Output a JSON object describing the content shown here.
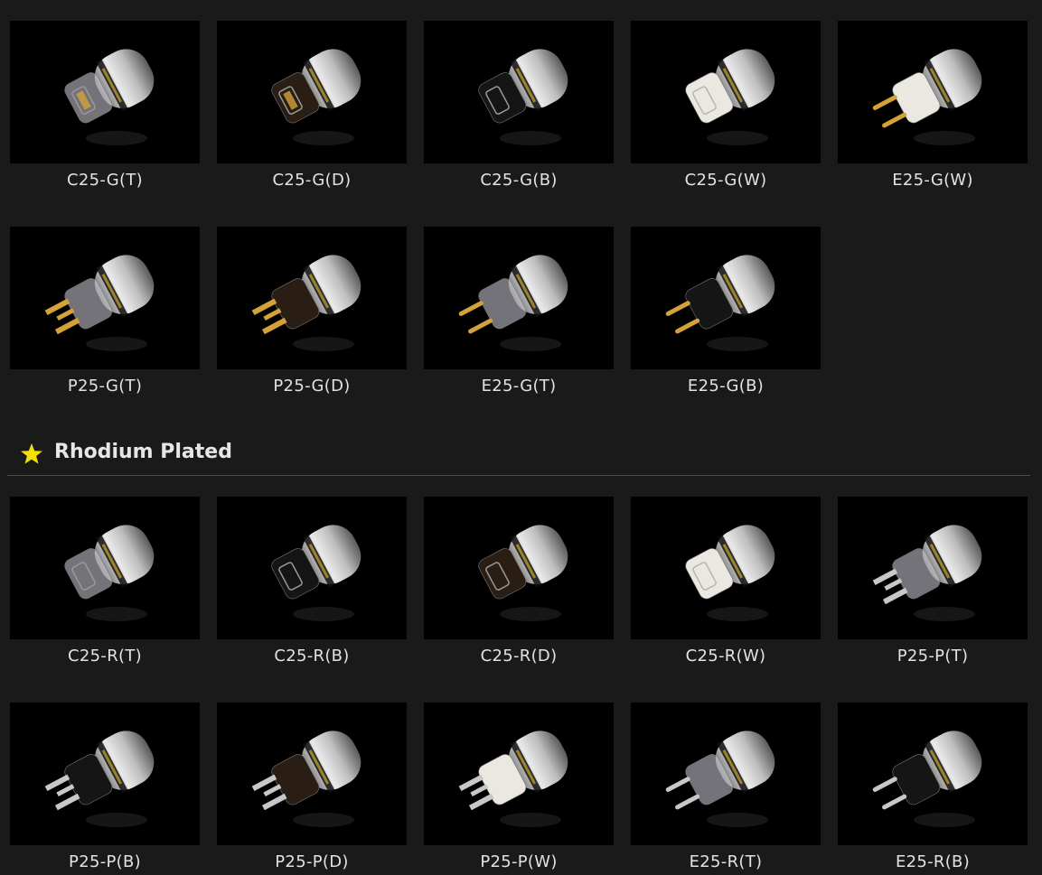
{
  "section_rhodium": {
    "title": "Rhodium Plated",
    "icon": "star-icon",
    "icon_color": "#f2e200"
  },
  "gold_row1": [
    {
      "label": "C25-G(T)",
      "kind": "iec-clear-gold"
    },
    {
      "label": "C25-G(D)",
      "kind": "iec-dark-gold"
    },
    {
      "label": "C25-G(B)",
      "kind": "iec-black"
    },
    {
      "label": "C25-G(W)",
      "kind": "iec-white"
    },
    {
      "label": "E25-G(W)",
      "kind": "schuko-white-gold"
    }
  ],
  "gold_row2": [
    {
      "label": "P25-G(T)",
      "kind": "us-clear-gold"
    },
    {
      "label": "P25-G(D)",
      "kind": "us-dark-gold"
    },
    {
      "label": "E25-G(T)",
      "kind": "schuko-clear-gold"
    },
    {
      "label": "E25-G(B)",
      "kind": "schuko-black-gold"
    }
  ],
  "rh_row1": [
    {
      "label": "C25-R(T)",
      "kind": "iec-clear"
    },
    {
      "label": "C25-R(B)",
      "kind": "iec-black"
    },
    {
      "label": "C25-R(D)",
      "kind": "iec-dark"
    },
    {
      "label": "C25-R(W)",
      "kind": "iec-white"
    },
    {
      "label": "P25-P(T)",
      "kind": "us-clear-silver"
    }
  ],
  "rh_row2": [
    {
      "label": "P25-P(B)",
      "kind": "us-black-silver"
    },
    {
      "label": "P25-P(D)",
      "kind": "us-dark-silver"
    },
    {
      "label": "P25-P(W)",
      "kind": "us-white-silver"
    },
    {
      "label": "E25-R(T)",
      "kind": "schuko-clear-silver"
    },
    {
      "label": "E25-R(B)",
      "kind": "schuko-black-silver"
    }
  ]
}
